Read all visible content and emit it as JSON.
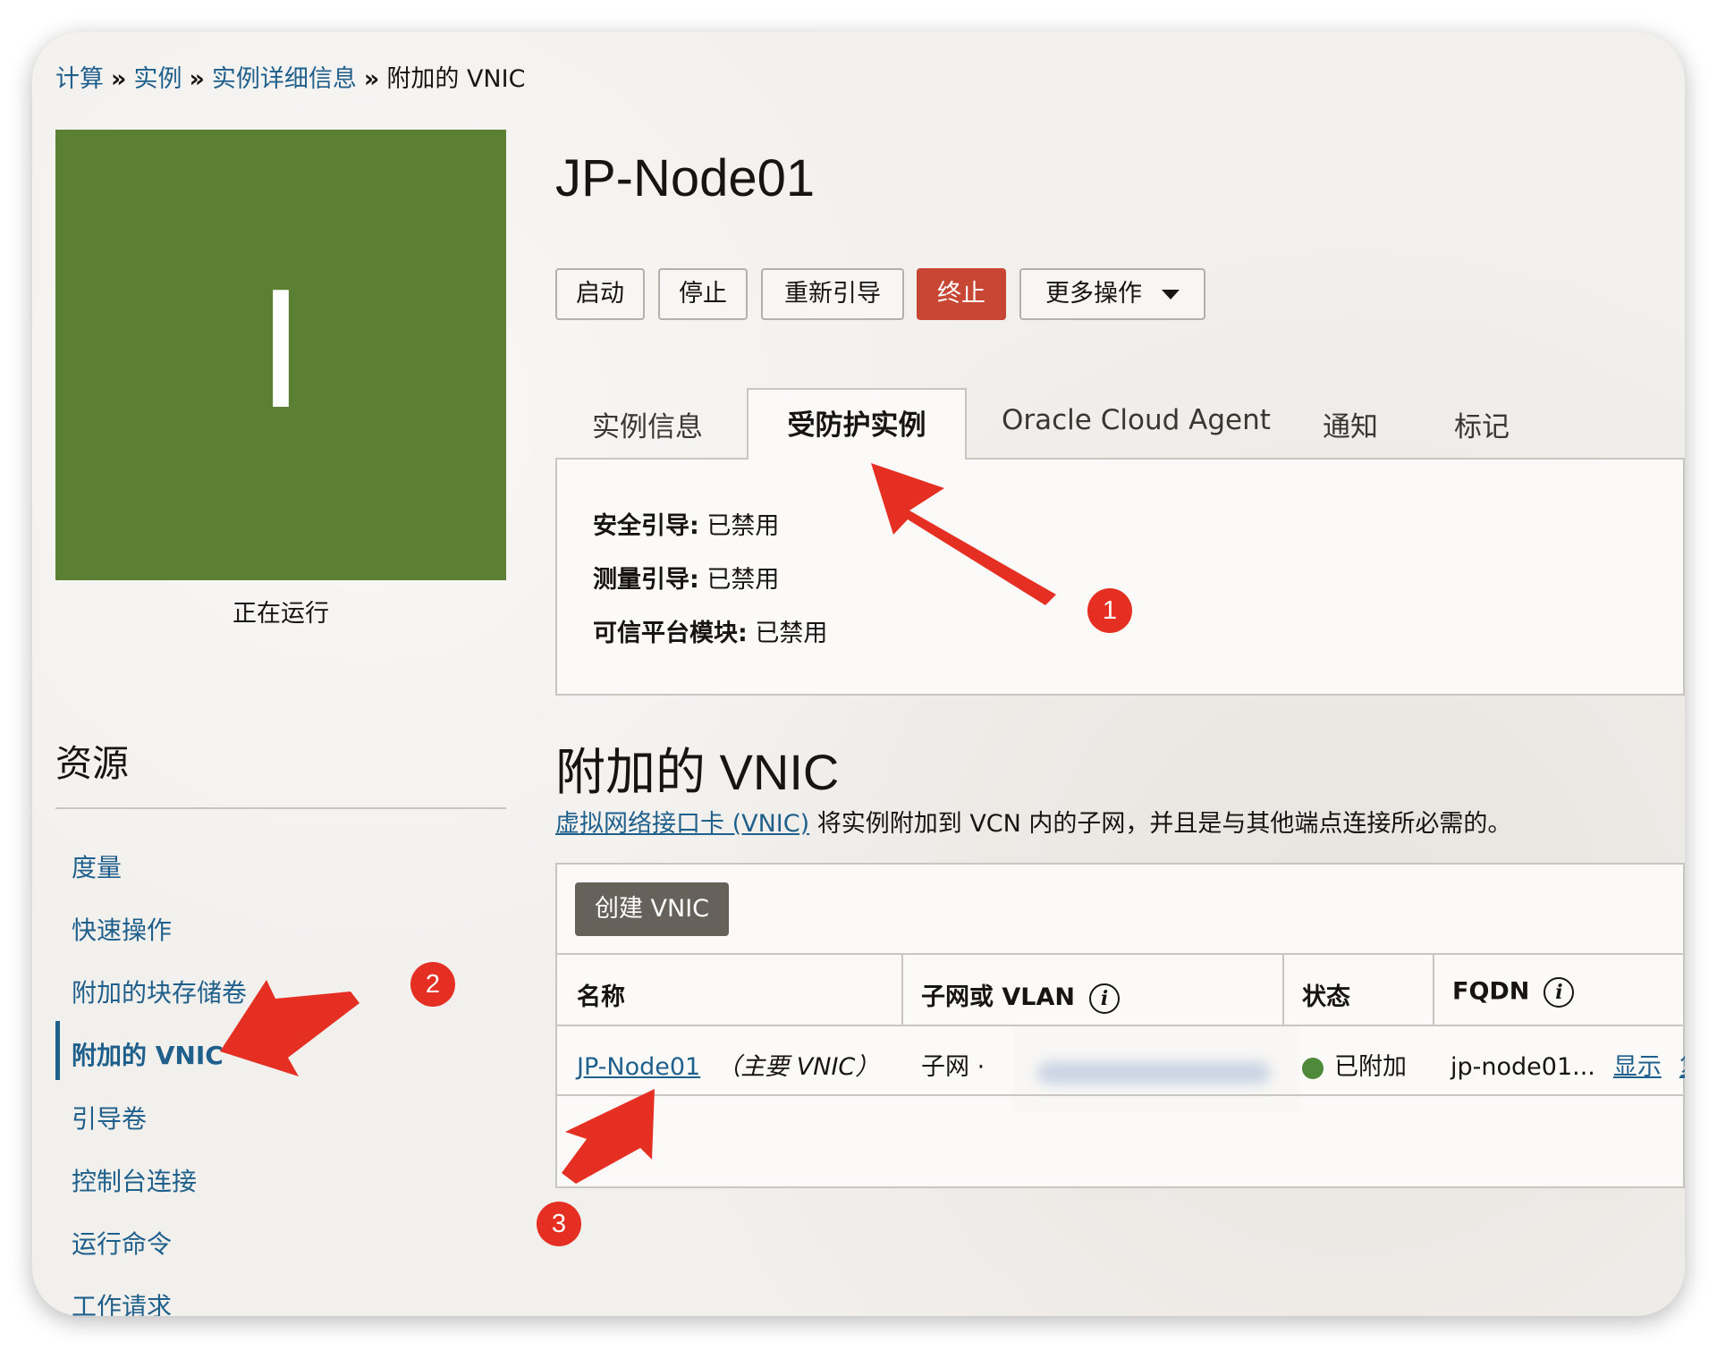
{
  "breadcrumb": {
    "items": [
      "计算",
      "实例",
      "实例详细信息"
    ],
    "current": "附加的 VNIC",
    "separator": "»"
  },
  "instance": {
    "tile_letter": "I",
    "tile_color": "#5b8033",
    "state": "正在运行",
    "name": "JP-Node01"
  },
  "actions": {
    "start": "启动",
    "stop": "停止",
    "reboot": "重新引导",
    "terminate": "终止",
    "more": "更多操作"
  },
  "tabs": [
    "实例信息",
    "受防护实例",
    "Oracle Cloud Agent",
    "通知",
    "标记"
  ],
  "active_tab": "受防护实例",
  "shielded": [
    {
      "label": "安全引导:",
      "value": "已禁用"
    },
    {
      "label": "测量引导:",
      "value": "已禁用"
    },
    {
      "label": "可信平台模块:",
      "value": "已禁用"
    }
  ],
  "resources": {
    "title": "资源",
    "items": [
      "度量",
      "快速操作",
      "附加的块存储卷",
      "附加的 VNIC",
      "引导卷",
      "控制台连接",
      "运行命令",
      "工作请求"
    ],
    "active": "附加的 VNIC"
  },
  "vnic": {
    "title": "附加的 VNIC",
    "desc_link": "虚拟网络接口卡 (VNIC)",
    "desc_text": "将实例附加到 VCN 内的子网，并且是与其他端点连接所必需的。",
    "create_button": "创建 VNIC",
    "columns": [
      "名称",
      "子网或 VLAN",
      "状态",
      "FQDN"
    ],
    "rows": [
      {
        "name": "JP-Node01",
        "name_note": "（主要 VNIC）",
        "subnet": "子网 ·",
        "status": "已附加",
        "status_color": "#4f8a3a",
        "fqdn": "jp-node01...",
        "fqdn_show": "显示",
        "fqdn_copy": "复"
      }
    ]
  },
  "annotations": {
    "markers": [
      "1",
      "2",
      "3"
    ],
    "color": "#e52f22"
  }
}
